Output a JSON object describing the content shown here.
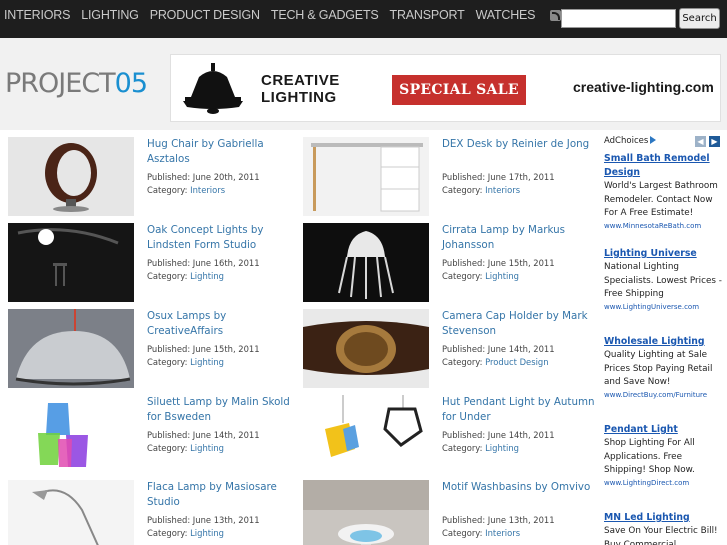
{
  "nav": {
    "items": [
      "INTERIORS",
      "LIGHTING",
      "PRODUCT DESIGN",
      "TECH & GADGETS",
      "TRANSPORT",
      "WATCHES"
    ],
    "rss_icon": "rss-icon",
    "mail_icon": "mail-icon"
  },
  "search": {
    "value": "",
    "placeholder": "",
    "button_label": "Search"
  },
  "logo": {
    "text": "PROJECT",
    "number": "05"
  },
  "banner": {
    "brand_line1": "CREATIVE",
    "brand_line2": "LIGHTING",
    "sale": "SPECIAL SALE",
    "url": "creative-lighting.com"
  },
  "posts": [
    {
      "title": "Hug Chair by Gabriella Asztalos",
      "date": "Published: June 20th, 2011",
      "category_label": "Category:",
      "category": "Interiors"
    },
    {
      "title": "DEX Desk by Reinier de Jong",
      "date": "Published: June 17th, 2011",
      "category_label": "Category:",
      "category": "Interiors"
    },
    {
      "title": "Oak Concept Lights by Lindsten Form Studio",
      "date": "Published: June 16th, 2011",
      "category_label": "Category:",
      "category": "Lighting"
    },
    {
      "title": "Cirrata Lamp by Markus Johansson",
      "date": "Published: June 15th, 2011",
      "category_label": "Category:",
      "category": "Lighting"
    },
    {
      "title": "Osux Lamps by CreativeAffairs",
      "date": "Published: June 15th, 2011",
      "category_label": "Category:",
      "category": "Lighting"
    },
    {
      "title": "Camera Cap Holder by Mark Stevenson",
      "date": "Published: June 14th, 2011",
      "category_label": "Category:",
      "category": "Product Design"
    },
    {
      "title": "Siluett Lamp by Malin Skold for Bsweden",
      "date": "Published: June 14th, 2011",
      "category_label": "Category:",
      "category": "Lighting"
    },
    {
      "title": "Hut Pendant Light by Autumn for Under",
      "date": "Published: June 14th, 2011",
      "category_label": "Category:",
      "category": "Lighting"
    },
    {
      "title": "Flaca Lamp by Masiosare Studio",
      "date": "Published: June 13th, 2011",
      "category_label": "Category:",
      "category": "Lighting"
    },
    {
      "title": "Motif Washbasins by Omvivo",
      "date": "Published: June 13th, 2011",
      "category_label": "Category:",
      "category": "Interiors"
    }
  ],
  "ads": {
    "adchoices": "AdChoices",
    "items": [
      {
        "title_line1": "Small Bath Remodel",
        "title_line2": "Design",
        "body": "World's Largest Bathroom Remodeler. Contact Now For A Free Estimate!",
        "url": "www.MinnesotaReBath.com"
      },
      {
        "title_line1": "Lighting Universe",
        "title_line2": "",
        "body": "National Lighting Specialists. Lowest Prices - Free Shipping",
        "url": "www.LightingUniverse.com"
      },
      {
        "title_line1": "Wholesale Lighting",
        "title_line2": "",
        "body": "Quality Lighting at Sale Prices Stop Paying Retail and Save Now!",
        "url": "www.DirectBuy.com/Furniture"
      },
      {
        "title_line1": "Pendant Light",
        "title_line2": "",
        "body": "Shop Lighting For All Applications. Free Shipping! Shop Now.",
        "url": "www.LightingDirect.com"
      },
      {
        "title_line1": "MN Led Lighting",
        "title_line2": "",
        "body": "Save On Your Electric Bill! Buy Commercial",
        "url": ""
      }
    ]
  }
}
